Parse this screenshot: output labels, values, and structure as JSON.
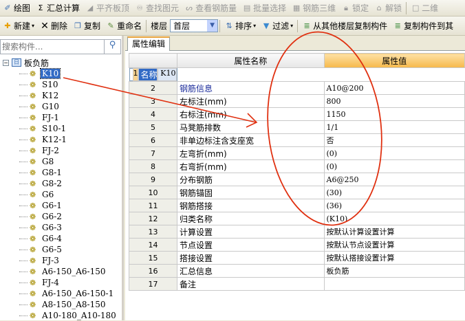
{
  "toolbar1": [
    {
      "label": "绘图",
      "icon": "draw-icon",
      "enabled": true
    },
    {
      "label": "汇总计算",
      "icon": "sigma-icon",
      "enabled": true
    },
    {
      "label": "平齐板顶",
      "icon": "align-icon",
      "enabled": false
    },
    {
      "label": "查找图元",
      "icon": "binoculars-icon",
      "enabled": false
    },
    {
      "label": "查看钢筋量",
      "icon": "view-rebar-icon",
      "enabled": false
    },
    {
      "label": "批量选择",
      "icon": "batch-select-icon",
      "enabled": false
    },
    {
      "label": "钢筋三维",
      "icon": "3d-icon",
      "enabled": false
    },
    {
      "label": "锁定",
      "icon": "lock-icon",
      "enabled": false
    },
    {
      "label": "解锁",
      "icon": "unlock-icon",
      "enabled": false
    },
    {
      "label": "二维",
      "icon": "2d-icon",
      "enabled": false
    }
  ],
  "toolbar2": {
    "new": "新建",
    "delete": "删除",
    "copy": "复制",
    "rename": "重命名",
    "floor_label": "楼层",
    "floor_value": "首层",
    "sort": "排序",
    "filter": "过滤",
    "copy_from": "从其他楼层复制构件",
    "copy_to": "复制构件到其"
  },
  "search": {
    "placeholder": "搜索构件..."
  },
  "tree": {
    "root": "板负筋",
    "selected": "K10",
    "items": [
      "K10",
      "S10",
      "K12",
      "G10",
      "FJ-1",
      "S10-1",
      "K12-1",
      "FJ-2",
      "G8",
      "G8-1",
      "G8-2",
      "G6",
      "G6-1",
      "G6-2",
      "G6-3",
      "G6-4",
      "G6-5",
      "FJ-3",
      "A6-150_A6-150",
      "FJ-4",
      "A6-150_A6-150-1",
      "A8-150_A8-150",
      "A10-180_A10-180"
    ]
  },
  "tab": "属性编辑",
  "grid": {
    "headers": [
      "属性名称",
      "属性值"
    ],
    "rows": [
      {
        "name": "名称",
        "value": "K10"
      },
      {
        "name": "钢筋信息",
        "value": "A10@200",
        "blue": true
      },
      {
        "name": "左标注(mm)",
        "value": "800"
      },
      {
        "name": "右标注(mm)",
        "value": "1150"
      },
      {
        "name": "马凳筋排数",
        "value": "1/1"
      },
      {
        "name": "非单边标注含支座宽",
        "value": "否"
      },
      {
        "name": "左弯折(mm)",
        "value": "(0)"
      },
      {
        "name": "右弯折(mm)",
        "value": "(0)"
      },
      {
        "name": "分布钢筋",
        "value": "A6@250"
      },
      {
        "name": "钢筋锚固",
        "value": "(30)"
      },
      {
        "name": "钢筋搭接",
        "value": "(36)"
      },
      {
        "name": "归类名称",
        "value": "(K10)"
      },
      {
        "name": "计算设置",
        "value": "按默认计算设置计算"
      },
      {
        "name": "节点设置",
        "value": "按默认节点设置计算"
      },
      {
        "name": "搭接设置",
        "value": "按默认搭接设置计算"
      },
      {
        "name": "汇总信息",
        "value": "板负筋"
      },
      {
        "name": "备注",
        "value": ""
      }
    ]
  },
  "annotation_color": "#e03010"
}
